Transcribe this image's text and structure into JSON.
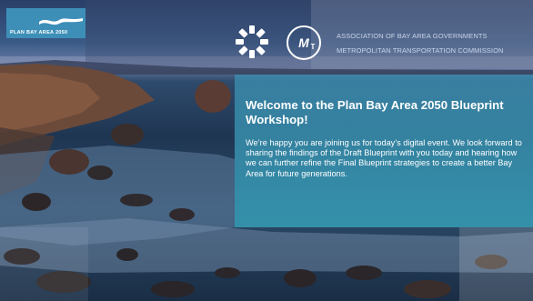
{
  "header": {
    "plan_logo_text": "PLAN BAY AREA 2050",
    "org_name_1": "ASSOCIATION OF BAY AREA GOVERNMENTS",
    "org_name_2": "METROPOLITAN TRANSPORTATION COMMISSION",
    "icons": [
      "plan-bay-area-wave-logo",
      "abag-sun-logo",
      "mtc-logo"
    ]
  },
  "welcome": {
    "title": "Welcome to the Plan Bay Area 2050 Blueprint Workshop!",
    "body": "We’re happy you are joining us for today’s digital event. We look forward to sharing the findings of the Draft Blueprint with you today and hearing how we can further refine the Final Blueprint strategies to create a better Bay Area for future generations."
  },
  "colors": {
    "panel": "#3c9cbc",
    "logo_box": "#3d8fb8",
    "org_text": "#c8d4ea"
  }
}
